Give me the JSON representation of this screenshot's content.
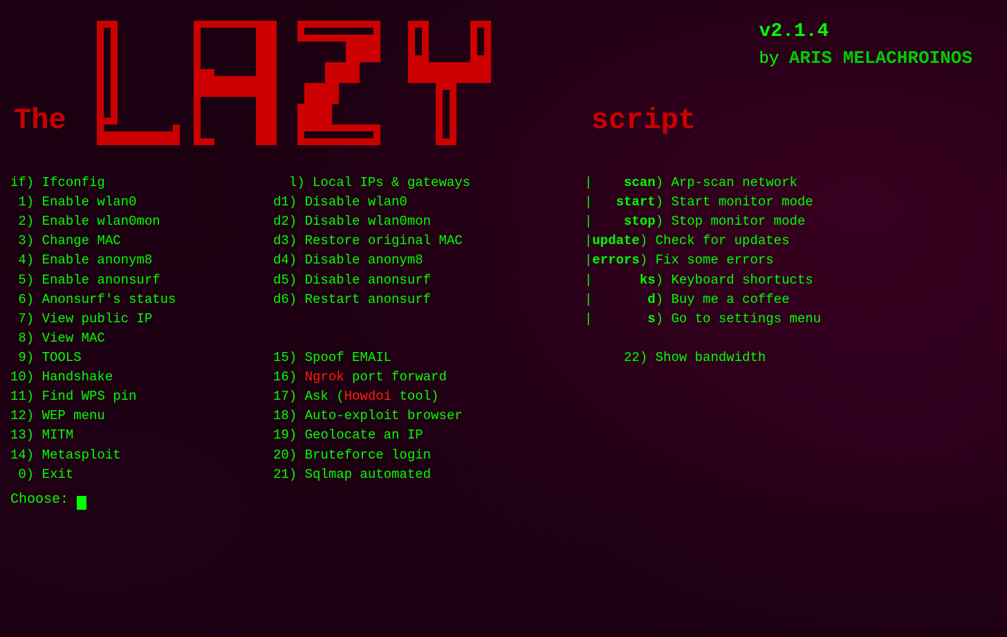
{
  "title": {
    "the": "The",
    "script": "script",
    "version": "v2.1.4",
    "by": "by",
    "author": "ARIS MELACHROINOS"
  },
  "menu": {
    "col1": [
      {
        "key": "if",
        "sep": ") ",
        "desc": "Ifconfig"
      },
      {
        "key": " 1",
        "sep": ") ",
        "desc": "Enable wlan0"
      },
      {
        "key": " 2",
        "sep": ") ",
        "desc": "Enable wlan0mon"
      },
      {
        "key": " 3",
        "sep": ") ",
        "desc": "Change MAC"
      },
      {
        "key": " 4",
        "sep": ") ",
        "desc": "Enable anonym8"
      },
      {
        "key": " 5",
        "sep": ") ",
        "desc": "Enable anonsurf"
      },
      {
        "key": " 6",
        "sep": ") ",
        "desc": "Anonsurf's status"
      },
      {
        "key": " 7",
        "sep": ") ",
        "desc": "View public IP"
      },
      {
        "key": " 8",
        "sep": ") ",
        "desc": "View MAC"
      },
      {
        "key": " 9",
        "sep": ") ",
        "desc": "TOOLS"
      },
      {
        "key": "10",
        "sep": ") ",
        "desc": "Handshake"
      },
      {
        "key": "11",
        "sep": ") ",
        "desc": "Find WPS pin"
      },
      {
        "key": "12",
        "sep": ") ",
        "desc": "WEP menu"
      },
      {
        "key": "13",
        "sep": ") ",
        "desc": "MITM"
      },
      {
        "key": "14",
        "sep": ") ",
        "desc": "Metasploit"
      },
      {
        "key": " 0",
        "sep": ") ",
        "desc": "Exit"
      }
    ],
    "col2": [
      {
        "key": "  l",
        "sep": ") ",
        "desc": "Local IPs & gateways"
      },
      {
        "key": "d1",
        "sep": ") ",
        "desc": "Disable wlan0"
      },
      {
        "key": "d2",
        "sep": ") ",
        "desc": "Disable wlan0mon"
      },
      {
        "key": "d3",
        "sep": ") ",
        "desc": "Restore original MAC"
      },
      {
        "key": "d4",
        "sep": ") ",
        "desc": "Disable anonym8"
      },
      {
        "key": "d5",
        "sep": ") ",
        "desc": "Disable anonsurf"
      },
      {
        "key": "d6",
        "sep": ") ",
        "desc": "Restart anonsurf"
      },
      {
        "key": "",
        "sep": "",
        "desc": ""
      },
      {
        "key": "",
        "sep": "",
        "desc": ""
      },
      {
        "key": "15",
        "sep": ") ",
        "desc": "Spoof EMAIL"
      },
      {
        "key": "16",
        "sep": ") ",
        "desc_parts": [
          {
            "text": "Ngrok",
            "color": "red"
          },
          {
            "text": " port forward",
            "color": "green"
          }
        ]
      },
      {
        "key": "17",
        "sep": ") ",
        "desc_parts": [
          {
            "text": "Ask (",
            "color": "green"
          },
          {
            "text": "Howdoi",
            "color": "red"
          },
          {
            "text": " tool)",
            "color": "green"
          }
        ]
      },
      {
        "key": "18",
        "sep": ") ",
        "desc": "Auto-exploit browser"
      },
      {
        "key": "19",
        "sep": ") ",
        "desc": "Geolocate an IP"
      },
      {
        "key": "20",
        "sep": ") ",
        "desc": "Bruteforce login"
      },
      {
        "key": "21",
        "sep": ") ",
        "desc": "Sqlmap automated"
      }
    ],
    "col3": [
      {
        "key": "  scan",
        "sep": ") ",
        "desc": "Arp-scan network"
      },
      {
        "key": " start",
        "sep": ") ",
        "desc": "Start monitor mode"
      },
      {
        "key": "  stop",
        "sep": ") ",
        "desc": "Stop monitor mode"
      },
      {
        "key": "update",
        "sep": ") ",
        "desc": "Check for updates"
      },
      {
        "key": "errors",
        "sep": ") ",
        "desc": "Fix some errors"
      },
      {
        "key": "    ks",
        "sep": ") ",
        "desc": "Keyboard shortucts"
      },
      {
        "key": "     d",
        "sep": ") ",
        "desc": "Buy me a coffee"
      },
      {
        "key": "     s",
        "sep": ") ",
        "desc": "Go to settings menu"
      },
      {
        "key": "",
        "sep": "",
        "desc": ""
      },
      {
        "key": "    22",
        "sep": ") ",
        "desc": "Show bandwidth"
      },
      {
        "key": "",
        "sep": "",
        "desc": ""
      },
      {
        "key": "",
        "sep": "",
        "desc": ""
      },
      {
        "key": "",
        "sep": "",
        "desc": ""
      },
      {
        "key": "",
        "sep": "",
        "desc": ""
      },
      {
        "key": "",
        "sep": "",
        "desc": ""
      },
      {
        "key": "",
        "sep": "",
        "desc": ""
      }
    ]
  },
  "prompt": {
    "choose_label": "Choose:"
  }
}
